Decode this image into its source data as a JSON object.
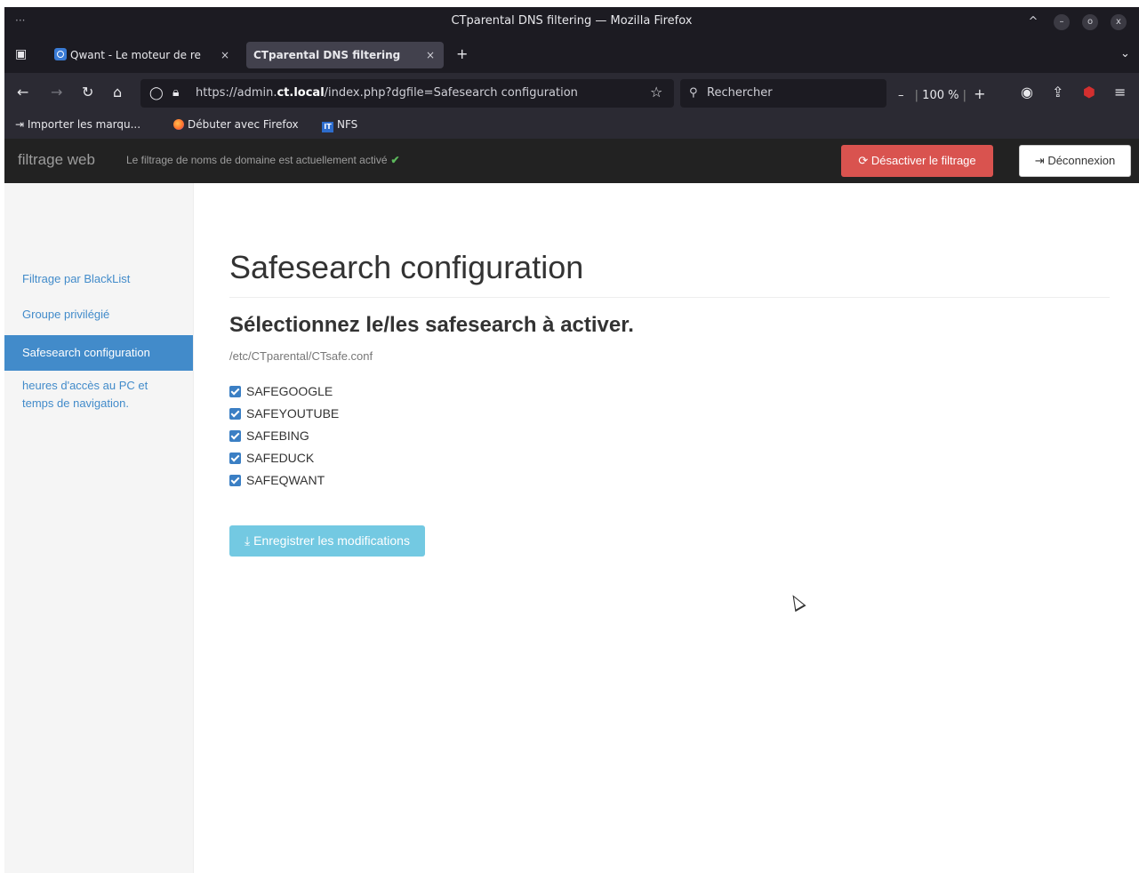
{
  "window": {
    "title": "CTparental DNS filtering — Mozilla Firefox",
    "controls": [
      "^",
      "–",
      "o",
      "x"
    ]
  },
  "tabs": [
    {
      "label": "Qwant - Le moteur de re",
      "icon": "qwant-icon",
      "active": false
    },
    {
      "label": "CTparental DNS filtering",
      "active": true
    }
  ],
  "tabbar": {
    "close": "×",
    "new_tab": "+",
    "list": "⌄"
  },
  "navbar": {
    "url_prefix": "https://admin.",
    "url_host": "ct.local",
    "url_path": "/index.php?dgfile=Safesearch configuration",
    "search_placeholder": "Rechercher",
    "zoom_level": "100 %",
    "zoom_out": "–",
    "zoom_in": "+"
  },
  "bookmarks": [
    {
      "label": "Importer les marqu...",
      "icon": "import-icon"
    },
    {
      "label": "Débuter avec Firefox",
      "icon": "firefox-icon"
    },
    {
      "label": "NFS",
      "icon": "it-icon"
    }
  ],
  "appbar": {
    "brand": "filtrage web",
    "status": "Le filtrage de noms de domaine est actuellement activé",
    "status_check": "✔",
    "disable_button": "Désactiver le filtrage",
    "logout_button": "Déconnexion"
  },
  "sidebar": {
    "items": [
      {
        "label": "Filtrage par BlackList",
        "active": false
      },
      {
        "label": "Groupe privilégié",
        "active": false
      },
      {
        "label": "Safesearch configuration",
        "active": true
      },
      {
        "label": "heures d'accès au PC et temps de navigation.",
        "active": false
      }
    ]
  },
  "main": {
    "title": "Safesearch configuration",
    "subtitle": "Sélectionnez le/les safesearch à activer.",
    "config_path": "/etc/CTparental/CTsafe.conf",
    "options": [
      {
        "label": "SAFEGOOGLE",
        "checked": true
      },
      {
        "label": "SAFEYOUTUBE",
        "checked": true
      },
      {
        "label": "SAFEBING",
        "checked": true
      },
      {
        "label": "SAFEDUCK",
        "checked": true
      },
      {
        "label": "SAFEQWANT",
        "checked": true
      }
    ],
    "save_button": "Enregistrer les modifications"
  },
  "colors": {
    "danger": "#d9534f",
    "primary": "#428bca",
    "info": "#5bc0de",
    "success": "#5cb85c"
  }
}
